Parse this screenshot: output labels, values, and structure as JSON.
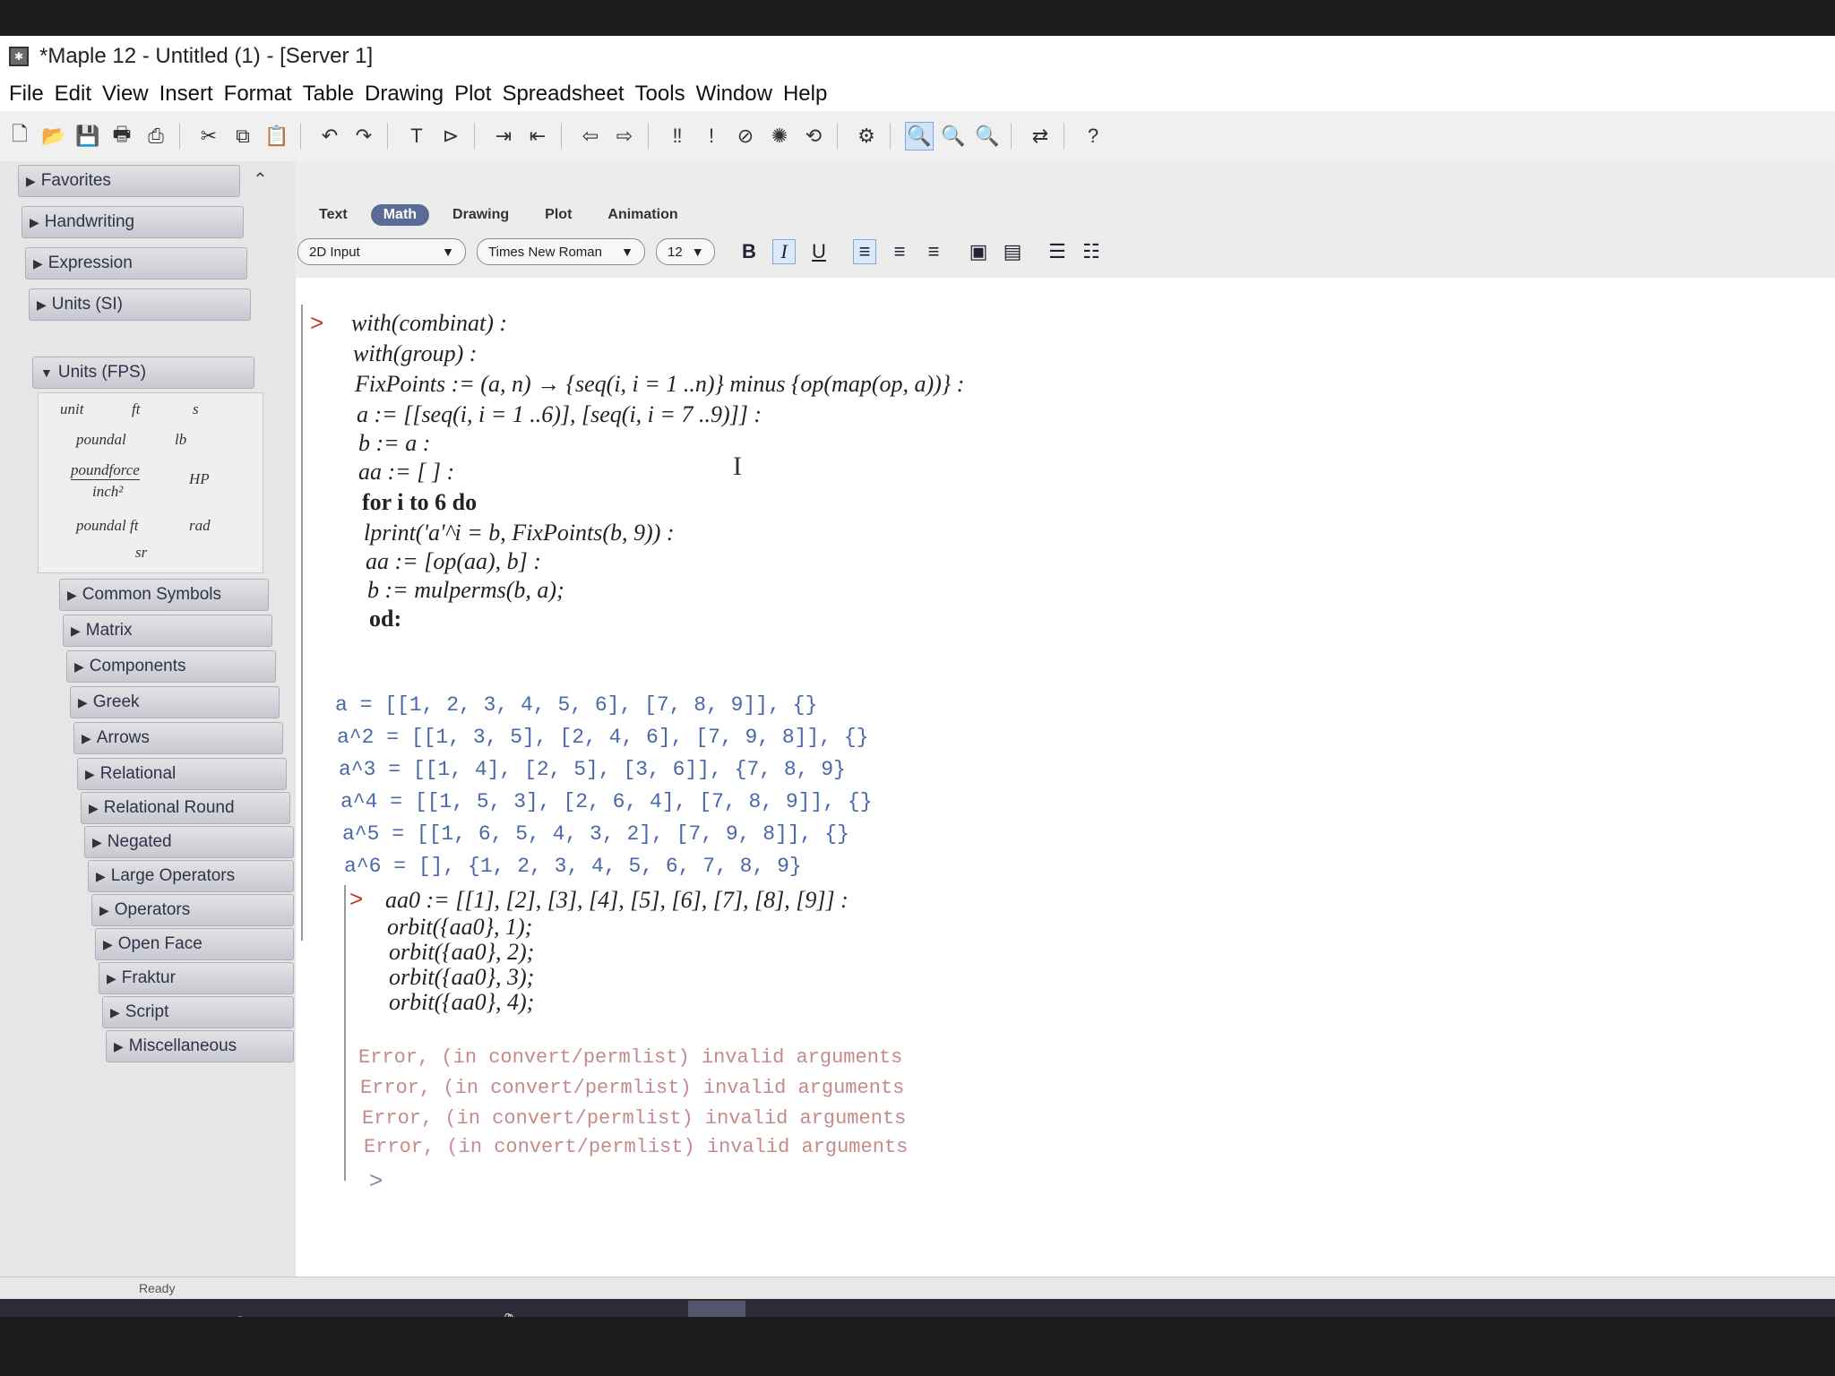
{
  "window": {
    "title": "*Maple 12 - Untitled (1) - [Server 1]"
  },
  "menu": [
    "File",
    "Edit",
    "View",
    "Insert",
    "Format",
    "Table",
    "Drawing",
    "Plot",
    "Spreadsheet",
    "Tools",
    "Window",
    "Help"
  ],
  "palettes": {
    "items": [
      "Favorites",
      "Handwriting",
      "Expression",
      "Units (SI)",
      "Units (FPS)",
      "Common Symbols",
      "Matrix",
      "Components",
      "Greek",
      "Arrows",
      "Relational",
      "Relational Round",
      "Negated",
      "Large Operators",
      "Operators",
      "Open Face",
      "Fraktur",
      "Script",
      "Miscellaneous"
    ],
    "units_fps": [
      "unit",
      "ft",
      "s",
      "poundal",
      "lb",
      "poundforce",
      "inch²",
      "HP",
      "poundal ft",
      "rad",
      "sr"
    ]
  },
  "context": {
    "tabs": [
      "Text",
      "Math",
      "Drawing",
      "Plot",
      "Animation"
    ],
    "active_tab": "Math",
    "input_mode": "2D Input",
    "font": "Times New Roman",
    "size": "12",
    "bold": "B",
    "italic": "I",
    "underline": "U"
  },
  "worksheet": {
    "code1": [
      "with(combinat) :",
      "with(group) :",
      "FixPoints := (a, n) → {seq(i, i = 1 ..n)} minus {op(map(op, a))} :",
      "a := [[seq(i, i = 1 ..6)], [seq(i, i = 7 ..9)]] :",
      "b := a :",
      "aa := [ ] :",
      "for i to 6 do",
      "lprint('a'^i = b, FixPoints(b, 9)) :",
      "aa := [op(aa), b] :",
      "b := mulperms(b, a);",
      "od:"
    ],
    "output1": [
      "a = [[1, 2, 3, 4, 5, 6], [7, 8, 9]], {}",
      "a^2 = [[1, 3, 5], [2, 4, 6], [7, 9, 8]], {}",
      "a^3 = [[1, 4], [2, 5], [3, 6]], {7, 8, 9}",
      "a^4 = [[1, 5, 3], [2, 6, 4], [7, 8, 9]], {}",
      "a^5 = [[1, 6, 5, 4, 3, 2], [7, 9, 8]], {}",
      "a^6 = [], {1, 2, 3, 4, 5, 6, 7, 8, 9}"
    ],
    "code2": [
      "aa0 := [[1], [2], [3], [4], [5], [6], [7], [8], [9]] :",
      "orbit({aa0}, 1);",
      "orbit({aa0}, 2);",
      "orbit({aa0}, 3);",
      "orbit({aa0}, 4);"
    ],
    "errors": [
      "Error, (in convert/permlist) invalid arguments",
      "Error, (in convert/permlist) invalid arguments",
      "Error, (in convert/permlist) invalid arguments",
      "Error, (in convert/permlist) invalid arguments"
    ],
    "prompt": ">"
  },
  "status": {
    "text": "Ready"
  },
  "taskbar": {
    "icons": [
      "windows-start-icon",
      "search-icon",
      "task-view-icon",
      "edge-icon",
      "file-explorer-icon",
      "store-icon",
      "browser-icon",
      "app-icon",
      "maple-icon"
    ]
  }
}
